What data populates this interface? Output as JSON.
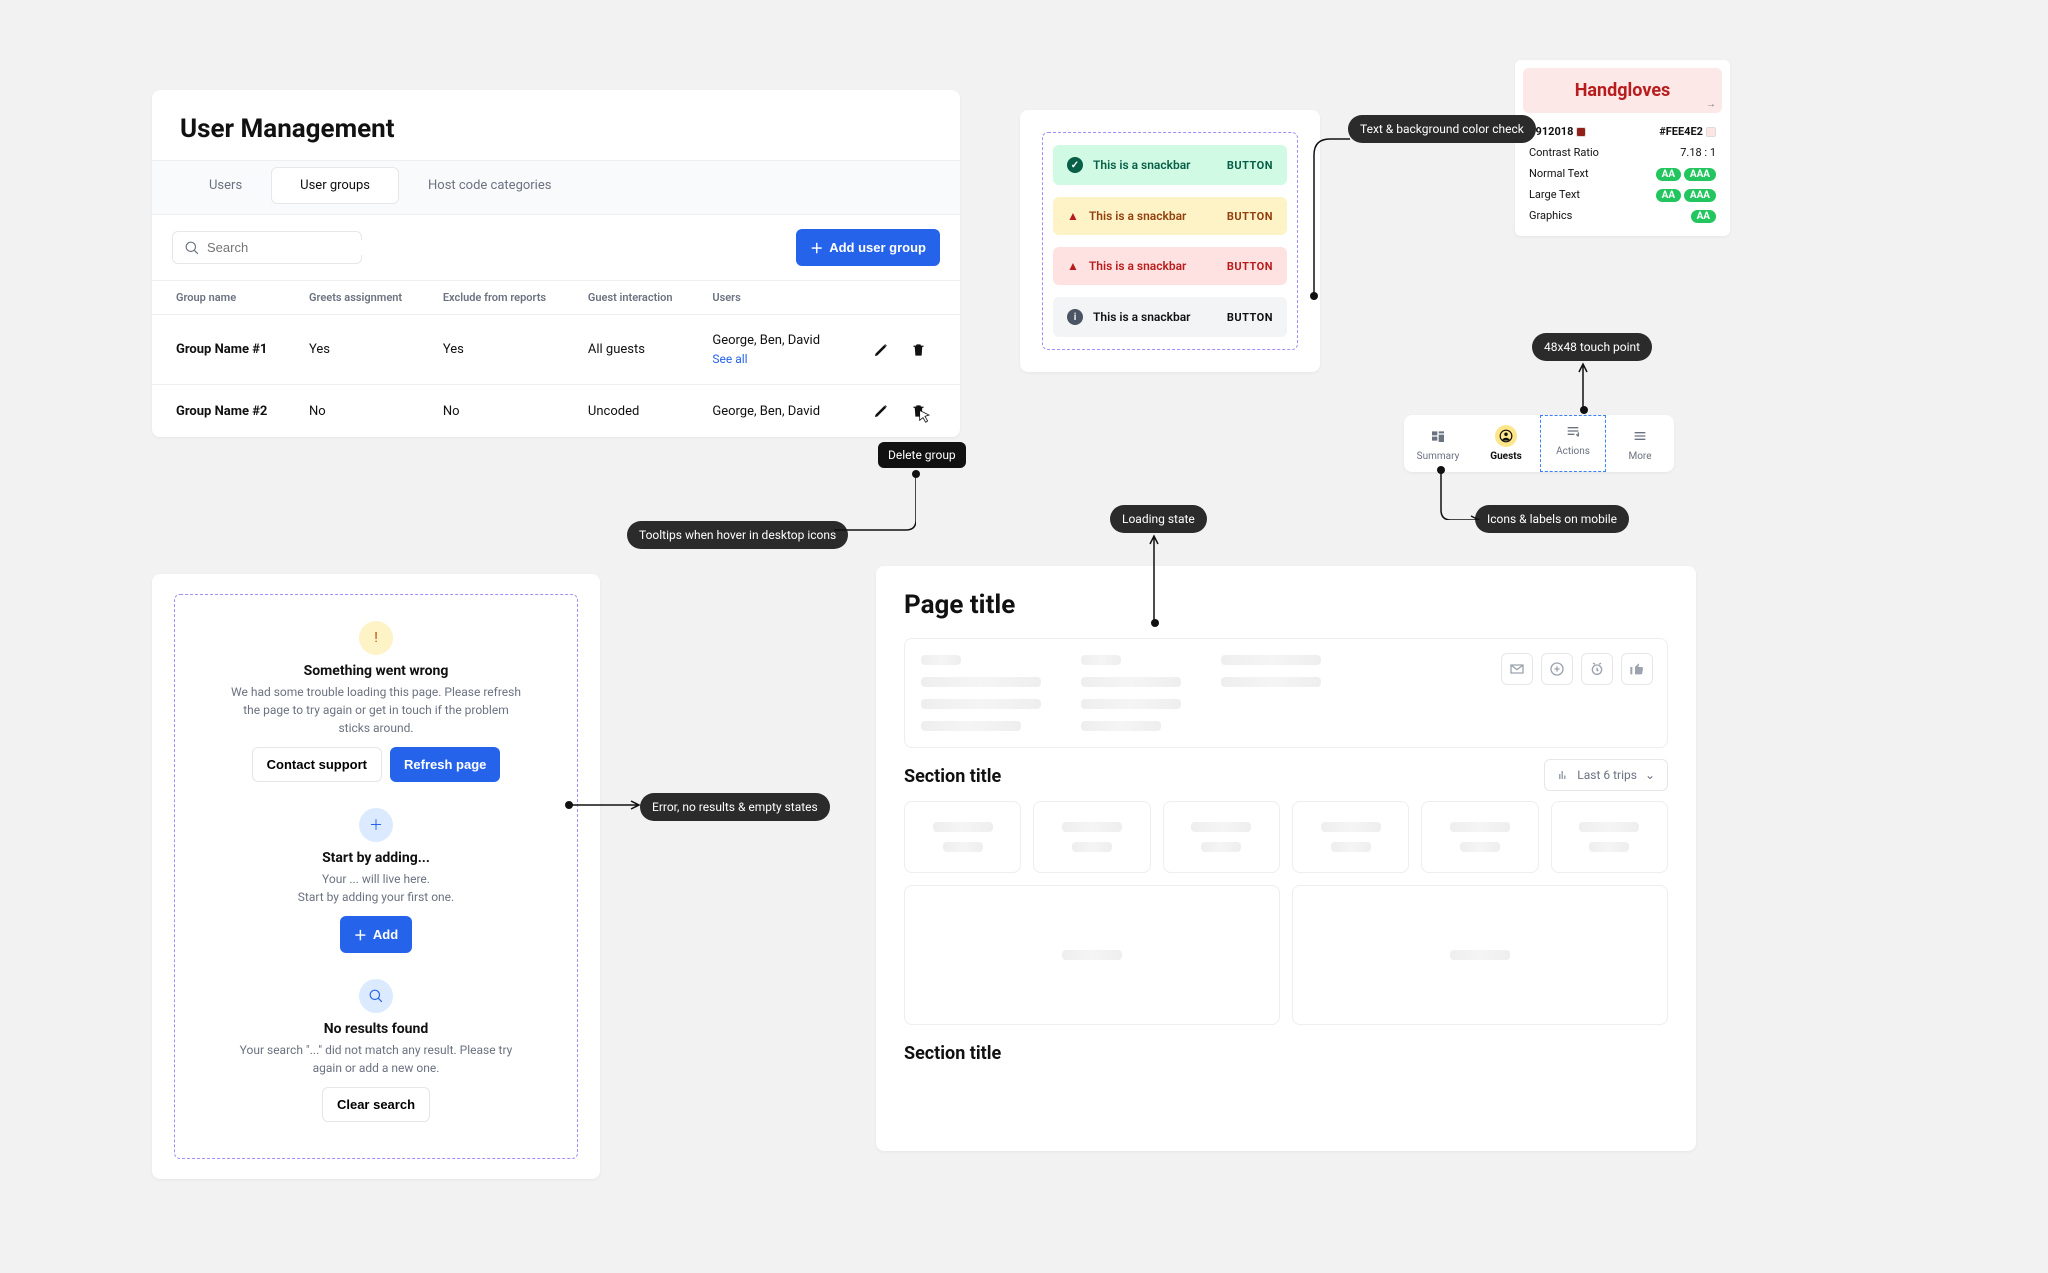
{
  "userManagement": {
    "title": "User Management",
    "tabs": [
      "Users",
      "User groups",
      "Host code categories"
    ],
    "activeTab": 1,
    "searchPlaceholder": "Search",
    "addButton": "Add user group",
    "columns": [
      "Group name",
      "Greets assignment",
      "Exclude from reports",
      "Guest interaction",
      "Users",
      ""
    ],
    "rows": [
      {
        "name": "Group Name #1",
        "greets": "Yes",
        "exclude": "Yes",
        "guest": "All guests",
        "users": "George, Ben, David",
        "seeAll": "See all"
      },
      {
        "name": "Group Name #2",
        "greets": "No",
        "exclude": "No",
        "guest": "Uncoded",
        "users": "George, Ben, David",
        "seeAll": ""
      }
    ],
    "deleteTooltip": "Delete group"
  },
  "emptyStates": {
    "error": {
      "title": "Something went wrong",
      "body": "We had some trouble loading this page. Please refresh the page to try again or get in touch if the problem sticks around.",
      "secondary": "Contact support",
      "primary": "Refresh page"
    },
    "empty": {
      "title": "Start by adding...",
      "body1": "Your ... will live here.",
      "body2": "Start by adding your first one.",
      "primary": "Add"
    },
    "noResults": {
      "title": "No results found",
      "body": "Your search \"...\" did not match any result. Please try again or add a new one.",
      "secondary": "Clear search"
    }
  },
  "snackbars": {
    "text": "This is a snackbar",
    "button": "BUTTON"
  },
  "contrast": {
    "sample": "Handgloves",
    "fg": "#912018",
    "bg": "#FEE4E2",
    "ratioLabel": "Contrast Ratio",
    "ratio": "7.18 : 1",
    "rows": [
      {
        "label": "Normal Text",
        "badges": [
          "AA",
          "AAA"
        ]
      },
      {
        "label": "Large Text",
        "badges": [
          "AA",
          "AAA"
        ]
      },
      {
        "label": "Graphics",
        "badges": [
          "AA"
        ]
      }
    ]
  },
  "mobileNav": {
    "items": [
      {
        "label": "Summary"
      },
      {
        "label": "Guests"
      },
      {
        "label": "Actions"
      },
      {
        "label": "More"
      }
    ],
    "activeIndex": 1,
    "focusIndex": 2
  },
  "skeleton": {
    "pageTitle": "Page title",
    "section1": "Section title",
    "section2": "Section title",
    "selector": "Last 6 trips"
  },
  "annotations": {
    "tooltips": "Tooltips when hover in desktop icons",
    "states": "Error, no results & empty states",
    "loading": "Loading state",
    "contrast": "Text & background color check",
    "touch": "48x48 touch point",
    "mobileNav": "Icons & labels on mobile"
  }
}
